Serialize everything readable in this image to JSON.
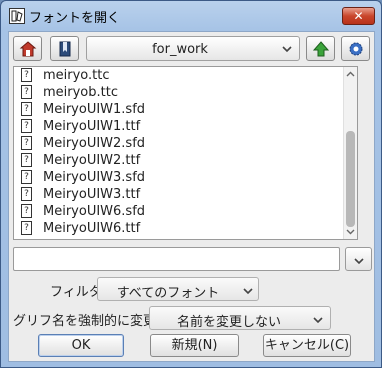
{
  "window": {
    "title": "フォントを開く",
    "close_label": "✕"
  },
  "toolbar": {
    "directory": "for_work"
  },
  "files": [
    "meiryo.ttc",
    "meiryob.ttc",
    "MeiryoUIW1.sfd",
    "MeiryoUIW1.ttf",
    "MeiryoUIW2.sfd",
    "MeiryoUIW2.ttf",
    "MeiryoUIW3.sfd",
    "MeiryoUIW3.ttf",
    "MeiryoUIW6.sfd",
    "MeiryoUIW6.ttf"
  ],
  "file_icon_glyph": "?",
  "filename_input": {
    "value": ""
  },
  "filter": {
    "label": "フィルタ:",
    "selected": "すべてのフォント"
  },
  "rename": {
    "label": "グリフ名を強制的に変更:",
    "selected": "名前を変更しない"
  },
  "buttons": {
    "ok": "OK",
    "new": "新規(N)",
    "cancel": "キャンセル(C)"
  },
  "colors": {
    "home_icon": "#c0392b",
    "up_arrow": "#3aa33a",
    "gear_icon": "#3a6fc4",
    "close_button": "#c9462c"
  }
}
